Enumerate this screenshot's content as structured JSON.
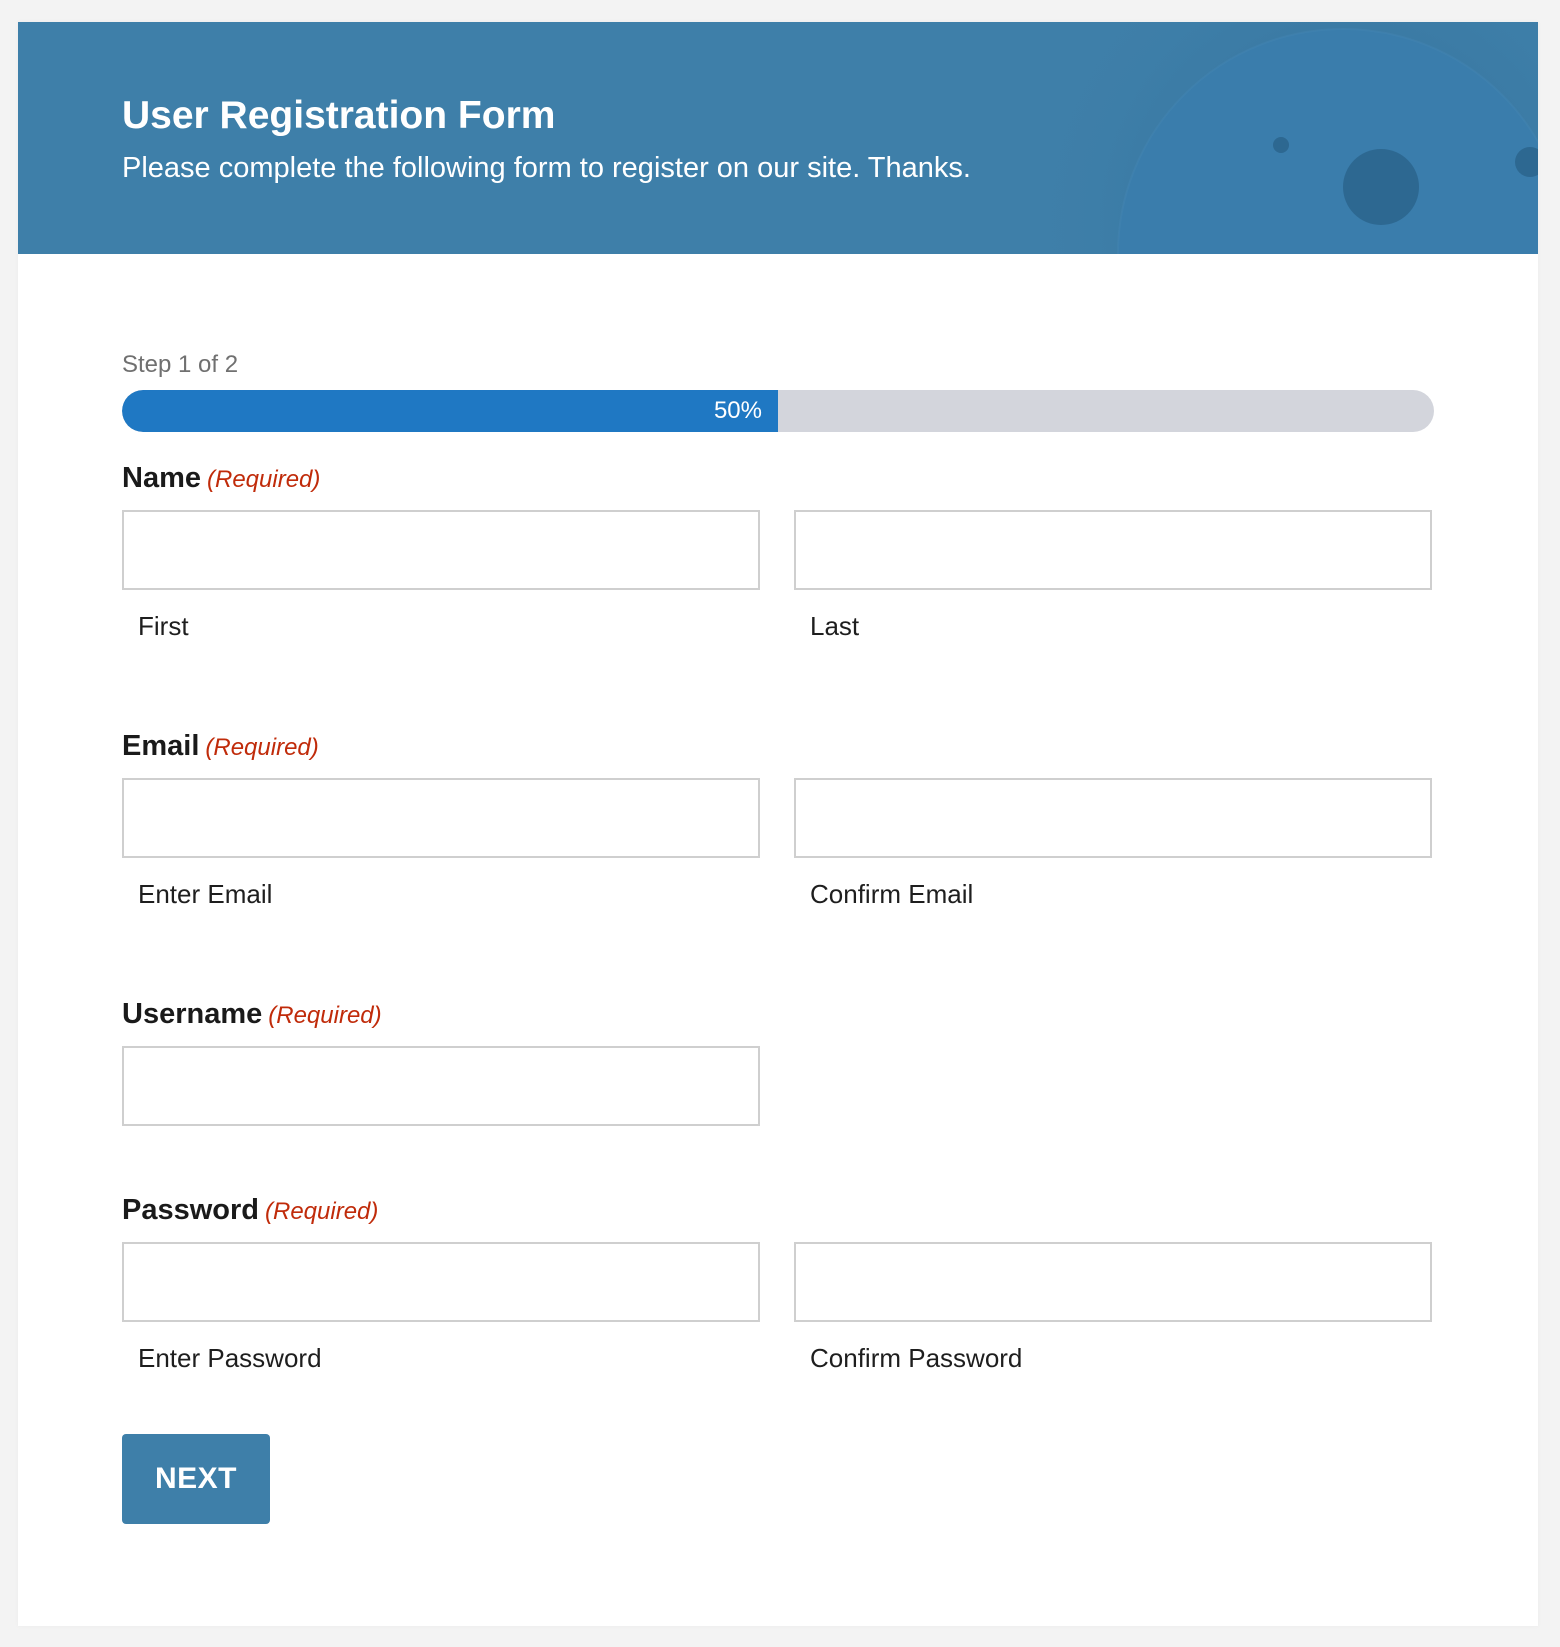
{
  "header": {
    "title": "User Registration Form",
    "subtitle": "Please complete the following form to register on our site. Thanks."
  },
  "progress": {
    "step_text": "Step 1 of 2",
    "percent_label": "50%",
    "fraction": 0.5
  },
  "fields": {
    "name": {
      "label": "Name",
      "required": "(Required)",
      "first": {
        "sublabel": "First",
        "value": ""
      },
      "last": {
        "sublabel": "Last",
        "value": ""
      }
    },
    "email": {
      "label": "Email",
      "required": "(Required)",
      "enter": {
        "sublabel": "Enter Email",
        "value": ""
      },
      "confirm": {
        "sublabel": "Confirm Email",
        "value": ""
      }
    },
    "username": {
      "label": "Username",
      "required": "(Required)",
      "value": ""
    },
    "password": {
      "label": "Password",
      "required": "(Required)",
      "enter": {
        "sublabel": "Enter Password",
        "value": ""
      },
      "confirm": {
        "sublabel": "Confirm Password",
        "value": ""
      }
    }
  },
  "actions": {
    "next_label": "NEXT"
  },
  "colors": {
    "header_bg": "#3e7fa9",
    "progress_fill": "#1f78c3",
    "progress_track": "#d3d5dc",
    "required": "#c02b0a",
    "button_bg": "#3e7fa9"
  }
}
